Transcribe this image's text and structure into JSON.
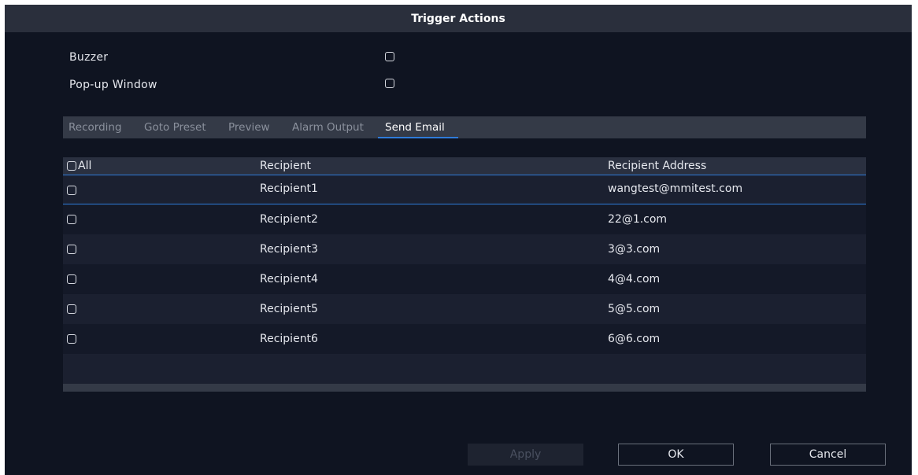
{
  "dialog": {
    "title": "Trigger Actions"
  },
  "options": {
    "buzzer_label": "Buzzer",
    "popup_label": "Pop-up Window"
  },
  "tabs": [
    {
      "label": "Recording",
      "active": false
    },
    {
      "label": "Goto Preset",
      "active": false
    },
    {
      "label": "Preview",
      "active": false
    },
    {
      "label": "Alarm Output",
      "active": false
    },
    {
      "label": "Send Email",
      "active": true
    }
  ],
  "table": {
    "headers": {
      "all": "All",
      "recipient": "Recipient",
      "address": "Recipient Address"
    },
    "rows": [
      {
        "recipient": "Recipient1",
        "address": "wangtest@mmitest.com"
      },
      {
        "recipient": "Recipient2",
        "address": "22@1.com"
      },
      {
        "recipient": "Recipient3",
        "address": "3@3.com"
      },
      {
        "recipient": "Recipient4",
        "address": "4@4.com"
      },
      {
        "recipient": "Recipient5",
        "address": "5@5.com"
      },
      {
        "recipient": "Recipient6",
        "address": "6@6.com"
      }
    ]
  },
  "buttons": {
    "apply": "Apply",
    "ok": "OK",
    "cancel": "Cancel"
  },
  "colors": {
    "accent": "#2f7bd9",
    "background": "#0f1421",
    "titlebar": "#2a2f3c"
  }
}
